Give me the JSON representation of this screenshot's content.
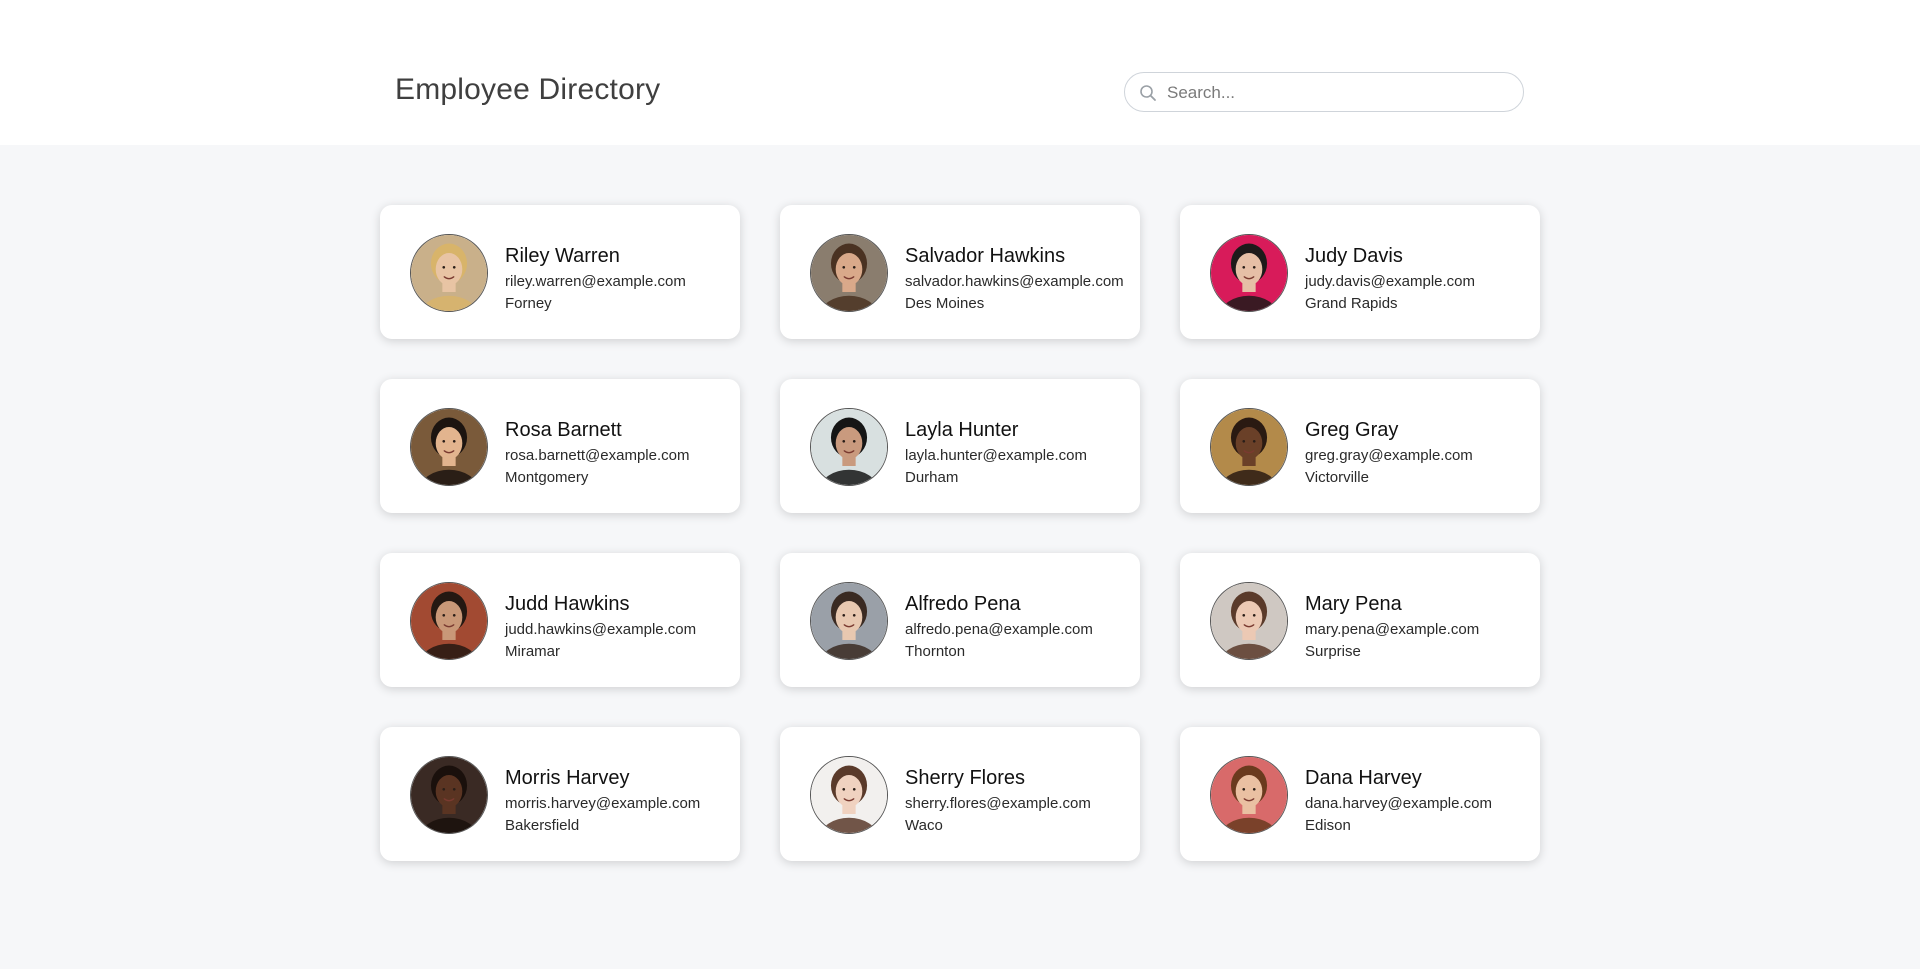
{
  "header": {
    "title": "Employee Directory"
  },
  "search": {
    "placeholder": "Search...",
    "value": ""
  },
  "employees": [
    {
      "name": "Riley Warren",
      "email": "riley.warren@example.com",
      "city": "Forney",
      "photo_bg": "#c9b08a",
      "skin": "#e8c4a4",
      "hair": "#d8b46a"
    },
    {
      "name": "Salvador Hawkins",
      "email": "salvador.hawkins@example.com",
      "city": "Des Moines",
      "photo_bg": "#8a7d6e",
      "skin": "#d9a98a",
      "hair": "#4a3222"
    },
    {
      "name": "Judy Davis",
      "email": "judy.davis@example.com",
      "city": "Grand Rapids",
      "photo_bg": "#d81b5a",
      "skin": "#e6bfa6",
      "hair": "#1e1a1a"
    },
    {
      "name": "Rosa Barnett",
      "email": "rosa.barnett@example.com",
      "city": "Montgomery",
      "photo_bg": "#7a5a3a",
      "skin": "#e2b48e",
      "hair": "#1c1410"
    },
    {
      "name": "Layla Hunter",
      "email": "layla.hunter@example.com",
      "city": "Durham",
      "photo_bg": "#d8e0e0",
      "skin": "#c99a7e",
      "hair": "#151515"
    },
    {
      "name": "Greg Gray",
      "email": "greg.gray@example.com",
      "city": "Victorville",
      "photo_bg": "#b38a4a",
      "skin": "#6a4028",
      "hair": "#2a1a12"
    },
    {
      "name": "Judd Hawkins",
      "email": "judd.hawkins@example.com",
      "city": "Miramar",
      "photo_bg": "#a24a32",
      "skin": "#c99878",
      "hair": "#241812"
    },
    {
      "name": "Alfredo Pena",
      "email": "alfredo.pena@example.com",
      "city": "Thornton",
      "photo_bg": "#9aa0a8",
      "skin": "#e8c8b0",
      "hair": "#3a2a22"
    },
    {
      "name": "Mary Pena",
      "email": "mary.pena@example.com",
      "city": "Surprise",
      "photo_bg": "#cfc8c2",
      "skin": "#ecc9b4",
      "hair": "#5a3a2a"
    },
    {
      "name": "Morris Harvey",
      "email": "morris.harvey@example.com",
      "city": "Bakersfield",
      "photo_bg": "#3a2a24",
      "skin": "#5a3422",
      "hair": "#1a100c"
    },
    {
      "name": "Sherry Flores",
      "email": "sherry.flores@example.com",
      "city": "Waco",
      "photo_bg": "#f2f0ee",
      "skin": "#f0d2c0",
      "hair": "#5a3a2a"
    },
    {
      "name": "Dana Harvey",
      "email": "dana.harvey@example.com",
      "city": "Edison",
      "photo_bg": "#d86a6a",
      "skin": "#eac0a2",
      "hair": "#6a3a1e"
    }
  ]
}
